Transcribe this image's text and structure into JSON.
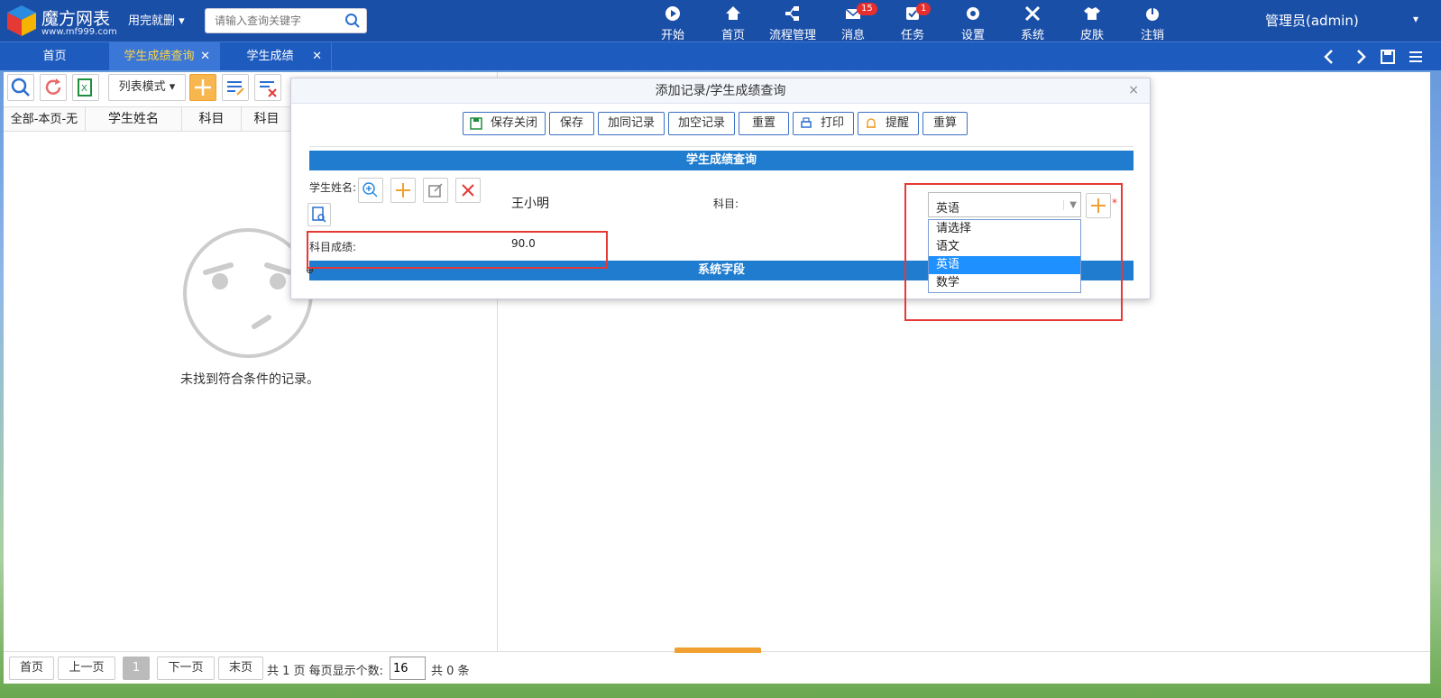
{
  "brand": {
    "name": "魔方网表",
    "site": "www.mf999.com"
  },
  "mode_switch": "用完就删",
  "search": {
    "placeholder": "请输入查询关键字"
  },
  "nav": [
    {
      "label": "开始",
      "icon": "play-icon"
    },
    {
      "label": "首页",
      "icon": "home-icon"
    },
    {
      "label": "流程管理",
      "icon": "workflow-icon"
    },
    {
      "label": "消息",
      "icon": "mail-icon",
      "badge": "15"
    },
    {
      "label": "任务",
      "icon": "task-icon",
      "badge": "1"
    },
    {
      "label": "设置",
      "icon": "gear-icon"
    },
    {
      "label": "系统",
      "icon": "tools-icon"
    },
    {
      "label": "皮肤",
      "icon": "shirt-icon"
    },
    {
      "label": "注销",
      "icon": "power-icon"
    }
  ],
  "user": {
    "name": "管理员(admin)"
  },
  "tabs": [
    {
      "label": "首页"
    },
    {
      "label": "学生成绩查询",
      "active": true
    },
    {
      "label": "学生成绩"
    }
  ],
  "tab_close": "✕",
  "list": {
    "mode_label": "列表模式",
    "columns": [
      "全部-本页-无",
      "学生姓名",
      "科目",
      "科目"
    ],
    "empty_text": "未找到符合条件的记录。"
  },
  "pager": {
    "first": "首页",
    "prev": "上一页",
    "current": "1",
    "next": "下一页",
    "last": "末页",
    "summary": "共 1 页 每页显示个数:",
    "page_size": "16",
    "total": "共 0 条"
  },
  "dialog": {
    "title": "添加记录/学生成绩查询",
    "close": "×",
    "buttons": {
      "save_close": "保存关闭",
      "save": "保存",
      "add_same": "加同记录",
      "add_empty": "加空记录",
      "reset": "重置",
      "print": "打印",
      "remind": "提醒",
      "recalc": "重算"
    },
    "section_main": "学生成绩查询",
    "section_system": "系统字段",
    "fields": {
      "student_label": "学生姓名:",
      "student_value": "王小明",
      "subject_label": "科目:",
      "subject_value": "英语",
      "score_label": "科目成绩:",
      "score_value": "90.0"
    },
    "subject_options": [
      "请选择",
      "语文",
      "英语",
      "数学"
    ],
    "required_mark": "*"
  },
  "colors": {
    "topbar": "#1a4fa8",
    "section": "#1f7ccf",
    "highlight": "#e53935",
    "selected": "#1e90ff"
  }
}
